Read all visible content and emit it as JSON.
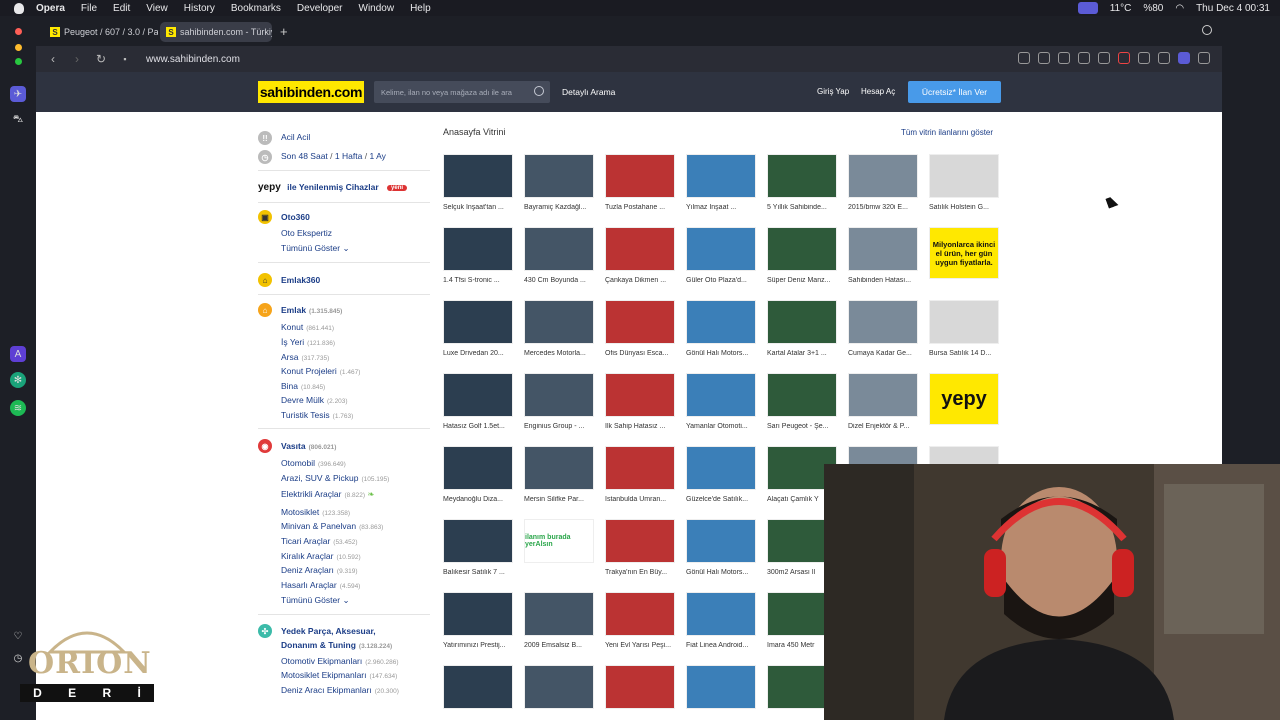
{
  "menubar": {
    "app": "Opera",
    "items": [
      "File",
      "Edit",
      "View",
      "History",
      "Bookmarks",
      "Developer",
      "Window",
      "Help"
    ],
    "temperature": "11°C",
    "battery": "%80",
    "datetime": "Thu Dec 4  00:31"
  },
  "tabs": [
    {
      "label": "Peugeot / 607 / 3.0 / Pa",
      "active": false
    },
    {
      "label": "sahibinden.com - Türkiy",
      "active": true
    }
  ],
  "address": {
    "url": "www.sahibinden.com"
  },
  "header": {
    "logo": "sahibinden.com",
    "search_placeholder": "Kelime, ilan no veya mağaza adı ile ara",
    "detayli": "Detaylı Arama",
    "giris": "Giriş Yap",
    "hesap": "Hesap Aç",
    "ilan_ver": "Ücretsiz* İlan Ver"
  },
  "left": {
    "acil": "Acil Acil",
    "son48_a": "Son 48 Saat",
    "son48_b": "1 Hafta",
    "son48_c": "1 Ay",
    "slash": "/",
    "yepy_logo": "yepy",
    "yepy_text": "ile Yenilenmiş Cihazlar",
    "yeni": "yeni",
    "oto360": "Oto360",
    "oto_ekspertiz": "Oto Ekspertiz",
    "tumunu1": "Tümünü Göster",
    "emlak360": "Emlak360",
    "emlak": {
      "label": "Emlak",
      "count": "(1.315.845)"
    },
    "emlak_items": [
      {
        "label": "Konut",
        "count": "(861.441)"
      },
      {
        "label": "İş Yeri",
        "count": "(121.836)"
      },
      {
        "label": "Arsa",
        "count": "(317.735)"
      },
      {
        "label": "Konut Projeleri",
        "count": "(1.467)"
      },
      {
        "label": "Bina",
        "count": "(10.845)"
      },
      {
        "label": "Devre Mülk",
        "count": "(2.203)"
      },
      {
        "label": "Turistik Tesis",
        "count": "(1.763)"
      }
    ],
    "vasita": {
      "label": "Vasıta",
      "count": "(806.021)"
    },
    "vasita_items": [
      {
        "label": "Otomobil",
        "count": "(396.649)"
      },
      {
        "label": "Arazi, SUV & Pickup",
        "count": "(105.195)"
      },
      {
        "label": "Elektrikli Araçlar",
        "count": "(8.822)"
      },
      {
        "label": "Motosiklet",
        "count": "(123.358)"
      },
      {
        "label": "Minivan & Panelvan",
        "count": "(83.863)"
      },
      {
        "label": "Ticari Araçlar",
        "count": "(53.452)"
      },
      {
        "label": "Kiralık Araçlar",
        "count": "(10.592)"
      },
      {
        "label": "Deniz Araçları",
        "count": "(9.319)"
      },
      {
        "label": "Hasarlı Araçlar",
        "count": "(4.594)"
      }
    ],
    "tumunu2": "Tümünü Göster",
    "yedek_a": "Yedek Parça, Aksesuar,",
    "yedek_b": "Donanım & Tuning",
    "yedek_count": "(3.128.224)",
    "yedek_items": [
      {
        "label": "Otomotiv Ekipmanları",
        "count": "(2.960.286)"
      },
      {
        "label": "Motosiklet Ekipmanları",
        "count": "(147.634)"
      },
      {
        "label": "Deniz Aracı Ekipmanları",
        "count": "(20.300)"
      }
    ]
  },
  "vitrin": {
    "title": "Anasayfa Vitrini",
    "all": "Tüm vitrin ilanlarını göster",
    "items": [
      "Selçuk İnşaat'tan ...",
      "Bayramiç Kazdağl...",
      "Tuzla Postahane ...",
      "Yılmaz İnşaat ...",
      "5 Yıllık Sahibinde...",
      "2015/bmw 320i E...",
      "Satılık Holstein G...",
      "1.4 Tfsi S-tronic ...",
      "430 Cm Boyunda ...",
      "Çankaya Dikmen ...",
      "Güler Oto Plaza'd...",
      "Süper Deniz Manz...",
      "Sahibinden Hatası...",
      "",
      "Luxe Drivedan 20...",
      "Mercedes Motorla...",
      "Ofis Dünyası Esca...",
      "Gönül Halı Motors...",
      "Kartal Atalar 3+1 ...",
      "Cumaya Kadar Ge...",
      "Bursa Satılık 14 D...",
      "Hatasız Golf 1.5et...",
      "Enginius Group - ...",
      "İlk Sahip Hatasız ...",
      "Yamanlar Otomoti...",
      "Sarı Peugeot - Şe...",
      "Dizel Enjektör & P...",
      "",
      "Meydanoğlu Diza...",
      "Mersin Silifke Par...",
      "İstanbulda Ümran...",
      "Güzelce'de Satılık...",
      "Alaçatı Çamlık Y",
      "",
      "",
      "Balıkesir Satılık 7 ...",
      "",
      "Trakya'nın En Büy...",
      "Gönül Halı Motors...",
      "300m2 Arsası İl",
      "",
      "",
      "Yatırımınızı Prestij...",
      "2009 Emsalsiz B...",
      "Yeni Evl Yarısı Peşi...",
      "Fiat Linea Android...",
      "İmara 450 Metr",
      "",
      "",
      "",
      "",
      "",
      "",
      "",
      "",
      ""
    ],
    "ad1": "Milyonlarca ikinci el ürün, her gün uygun fiyatlarla.",
    "ad2": "yepy",
    "ad3": "ilanım burada yerAlsın"
  },
  "overlay": {
    "orion": "ORION",
    "deri": [
      "D",
      "E",
      "R",
      "İ"
    ]
  }
}
